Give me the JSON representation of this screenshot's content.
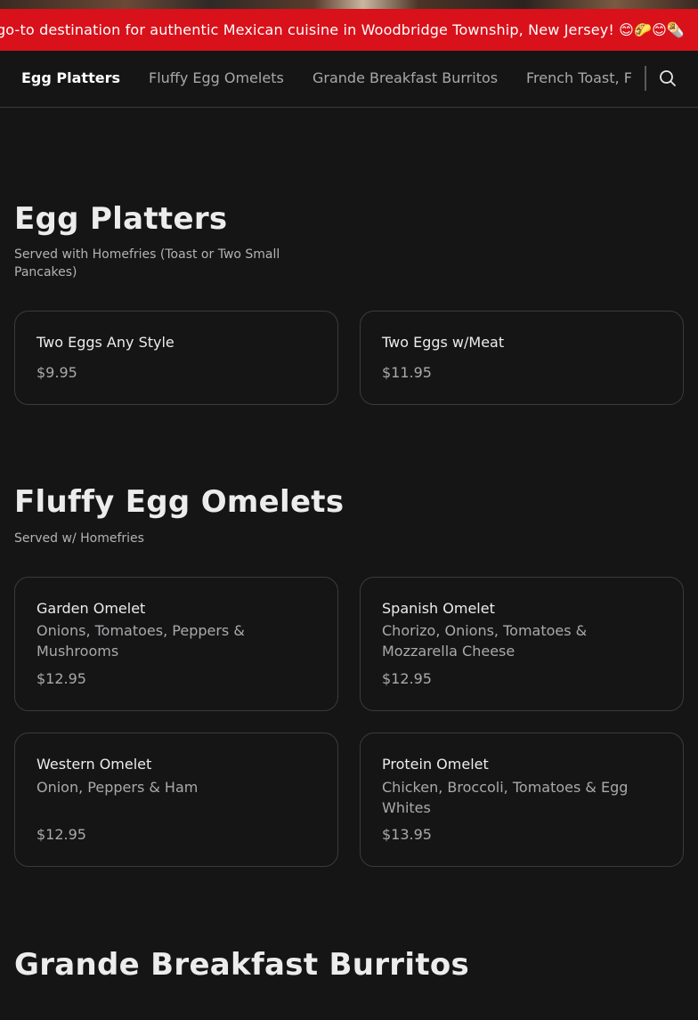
{
  "banner": {
    "text": "go-to destination for authentic Mexican cuisine in Woodbridge Township, New Jersey! 😊🌮😊🌯"
  },
  "nav": {
    "tabs": [
      {
        "label": "Egg Platters",
        "active": true
      },
      {
        "label": "Fluffy Egg Omelets",
        "active": false
      },
      {
        "label": "Grande Breakfast Burritos",
        "active": false
      },
      {
        "label": "French Toast, F",
        "active": false
      }
    ],
    "search_icon": "search-icon"
  },
  "sections": [
    {
      "title": "Egg Platters",
      "subtitle": "Served with Homefries (Toast or Two Small Pancakes)",
      "items": [
        {
          "name": "Two Eggs Any Style",
          "description": "",
          "price": "$9.95"
        },
        {
          "name": "Two Eggs w/Meat",
          "description": "",
          "price": "$11.95"
        }
      ]
    },
    {
      "title": "Fluffy Egg Omelets",
      "subtitle": "Served w/ Homefries",
      "items": [
        {
          "name": "Garden Omelet",
          "description": "Onions, Tomatoes, Peppers & Mushrooms",
          "price": "$12.95"
        },
        {
          "name": "Spanish Omelet",
          "description": "Chorizo, Onions, Tomatoes & Mozzarella Cheese",
          "price": "$12.95"
        },
        {
          "name": "Western Omelet",
          "description": "Onion, Peppers & Ham",
          "price": "$12.95"
        },
        {
          "name": "Protein Omelet",
          "description": "Chicken, Broccoli, Tomatoes & Egg Whites",
          "price": "$13.95"
        }
      ]
    },
    {
      "title": "Grande Breakfast Burritos",
      "subtitle": "",
      "items": []
    }
  ],
  "colors": {
    "background": "#151516",
    "banner": "#d9111b",
    "card_border": "#3b3b3e",
    "text_primary": "#ececec",
    "text_secondary": "#a9a9ac"
  }
}
